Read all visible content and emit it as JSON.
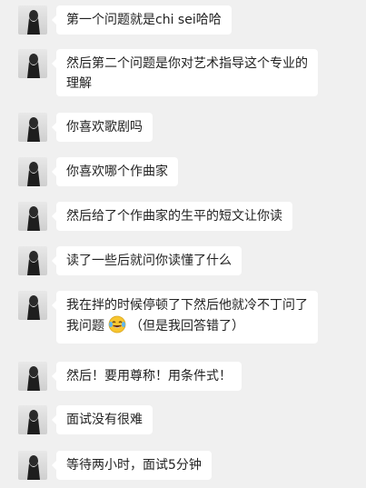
{
  "messages": [
    {
      "lines": [
        "第一个问题就是chi sei哈哈"
      ]
    },
    {
      "lines": [
        "然后第二个问题是你对艺术指导这个专业的",
        "理解"
      ]
    },
    {
      "lines": [
        "你喜欢歌剧吗"
      ]
    },
    {
      "lines": [
        "你喜欢哪个作曲家"
      ]
    },
    {
      "lines": [
        "然后给了个作曲家的生平的短文让你读"
      ]
    },
    {
      "lines": [
        "读了一些后就问你读懂了什么"
      ]
    },
    {
      "lines": [
        "我在拌的时候停顿了下然后他就冷不丁问了",
        "我问题",
        "（但是我回答错了）"
      ],
      "emoji": "laughing-tears-icon"
    },
    {
      "lines": [
        "然后！要用尊称！用条件式！"
      ]
    },
    {
      "lines": [
        "面试没有很难"
      ]
    },
    {
      "lines": [
        "等待两小时，面试5分钟"
      ]
    }
  ],
  "colors": {
    "background": "#f0f0f0",
    "bubble": "#ffffff",
    "text": "#222222"
  }
}
